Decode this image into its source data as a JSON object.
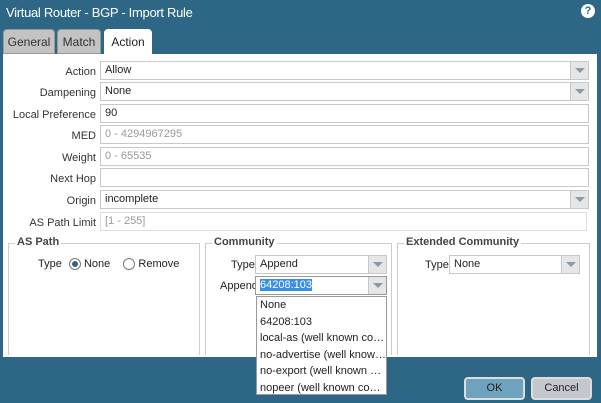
{
  "window": {
    "title": "Virtual Router - BGP - Import Rule",
    "help_icon": "question-circle-icon"
  },
  "tabs": [
    {
      "label": "General"
    },
    {
      "label": "Match"
    },
    {
      "label": "Action",
      "active": true
    }
  ],
  "form": {
    "action": {
      "label": "Action",
      "value": "Allow"
    },
    "dampening": {
      "label": "Dampening",
      "value": "None"
    },
    "local_preference": {
      "label": "Local Preference",
      "value": "90"
    },
    "med": {
      "label": "MED",
      "placeholder": "0 - 4294967295"
    },
    "weight": {
      "label": "Weight",
      "placeholder": "0 - 65535"
    },
    "next_hop": {
      "label": "Next Hop",
      "value": ""
    },
    "origin": {
      "label": "Origin",
      "value": "incomplete"
    },
    "as_path_limit": {
      "label": "AS Path Limit",
      "placeholder": "[1 - 255]"
    }
  },
  "as_path": {
    "title": "AS Path",
    "type_label": "Type",
    "options": [
      "None",
      "Remove"
    ],
    "selected": "None"
  },
  "community": {
    "title": "Community",
    "type_label": "Type",
    "type_value": "Append",
    "append_label": "Append",
    "append_value": "64208:103",
    "dropdown": [
      "None",
      "64208:103",
      "local-as (well known comm...",
      "no-advertise (well known c...",
      "no-export (well known com...",
      "nopeer (well known comm..."
    ]
  },
  "extended_community": {
    "title": "Extended Community",
    "type_label": "Type",
    "type_value": "None"
  },
  "footer": {
    "ok": "OK",
    "cancel": "Cancel"
  },
  "colors": {
    "chrome": "#2e6785",
    "ok_button": "#6fa3bd",
    "cancel_button": "#c4c8cc",
    "selection": "#3a8ee6"
  }
}
